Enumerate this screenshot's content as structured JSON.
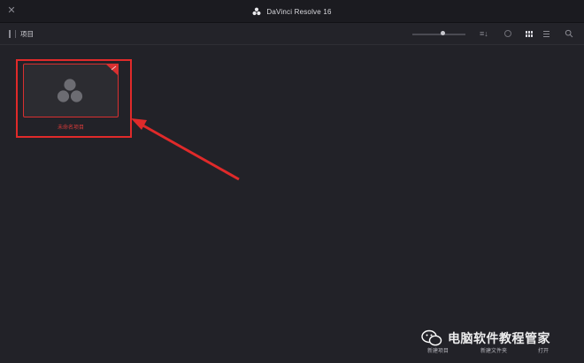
{
  "window": {
    "title": "DaVinci Resolve 16",
    "close_icon": "close-icon",
    "logo_icon": "davinci-logo-icon"
  },
  "toolbar": {
    "section_label": "项目",
    "icons": [
      "panel-toggle-icon",
      "sort-icon",
      "info-icon",
      "grid-view-icon",
      "list-view-icon",
      "search-icon"
    ],
    "thumbnail_size": 0.58
  },
  "projects": [
    {
      "name": "未命名项目",
      "highlight_color": "#e02a2a"
    }
  ],
  "bottom_bar": {
    "new_project": "新建项目",
    "new_folder": "新建文件夹",
    "open": "打开"
  },
  "watermark": {
    "text": "电脑软件教程管家",
    "icon": "wechat-icon"
  },
  "colors": {
    "background": "#222228",
    "titlebar": "#1b1b20",
    "annotation": "#e02a2a"
  }
}
